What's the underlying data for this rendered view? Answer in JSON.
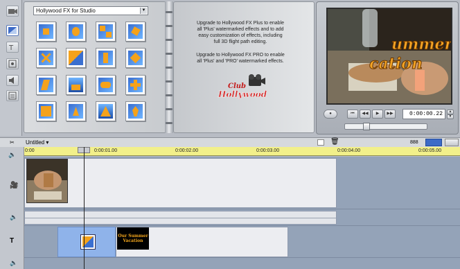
{
  "album": {
    "dropdown_value": "Hollywood FX for Studio"
  },
  "info": {
    "upgrade_plus": "Upgrade to Hollywood FX Plus to enable all 'Plus' watermarked effects and to add easy customization of effects, including full 3D flight path editing.",
    "upgrade_pro": "Upgrade to Hollywood FX PRO to enable all 'Plus' and 'PRO' watermarked effects.",
    "logo_top": "Club",
    "logo_bottom": "Hollywood"
  },
  "player": {
    "timecode": "0:00:00.22",
    "video_text_1": "ummer",
    "video_text_2": "cation"
  },
  "timeline": {
    "project_title": "Untitled",
    "ruler_labels": [
      "0:00",
      "0:00:01.00",
      "0:00:02.00",
      "0:00:03.00",
      "0:00:04.00",
      "0:00:05.00"
    ],
    "title_clip_text": "Our Summer Vacation",
    "zoom_icon_label": "888"
  }
}
